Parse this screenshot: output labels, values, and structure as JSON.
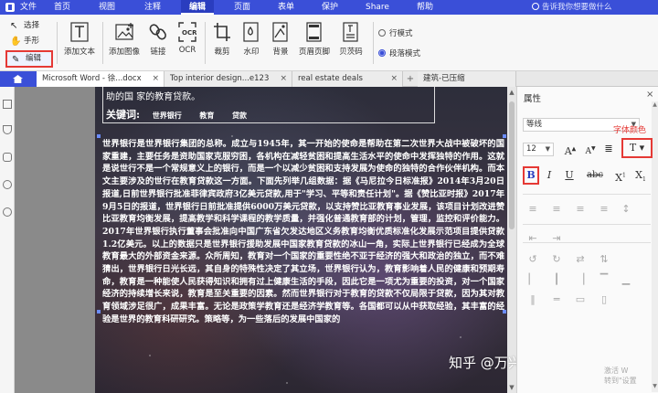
{
  "menu": {
    "items": [
      "文件",
      "首页",
      "视图",
      "注释",
      "编辑",
      "页面",
      "表单",
      "保护",
      "Share",
      "帮助"
    ],
    "active_index": 4,
    "tip": "告诉我你想要做什么"
  },
  "ribbon": {
    "modes": {
      "select": "选择",
      "hand": "手形",
      "edit": "编辑"
    },
    "buttons": {
      "add_text": "添加文本",
      "add_image": "添加图像",
      "link": "链接",
      "ocr": "OCR",
      "crop": "裁剪",
      "watermark": "水印",
      "background": "背景",
      "header_footer": "页眉页脚",
      "bates": "贝茨码"
    },
    "radio": {
      "line_mode": "行模式",
      "paragraph_mode": "段落模式",
      "selected": "paragraph_mode"
    }
  },
  "tabs": [
    {
      "label": "Microsoft Word - 徐...docx",
      "active": true
    },
    {
      "label": "Top interior design...e123",
      "active": false
    },
    {
      "label": "real estate deals",
      "active": false
    },
    {
      "label": "建筑-已压缩",
      "active": false
    }
  ],
  "document": {
    "abstract_tail": "助的国  家的教育贷款。",
    "keywords_label": "关键词:",
    "keywords": [
      "世界银行",
      "教育",
      "贷款"
    ],
    "paragraph": "世界银行是世界银行集团的总称。成立与1945年，其一开始的使命是帮助在第二次世界大战中被破坏的国家重建，主要任务是资助国家克服穷困，各机构在减轻贫困和提高生活水平的使命中发挥独特的作用。这就是说世行不是一个常规意义上的银行，而是一个以减少贫困和支持发展为使命的独特的合作伙伴机构。而本文主要涉及的世行在教育贷款这一方面。下面先列举几组数据：据《马尼拉今日标准报》2014年3月20日报道,日前世界银行批准菲律宾政府3亿美元贷款,用于\"学习、平等和责任计划\"。据《赞比亚时报》2017年9月5日的报道，世界银行日前批准提供6000万美元贷款，以支持赞比亚教育事业发展，该项目计划改进赞比亚教育均衡发展，提高教学和科学课程的教学质量，并强化普通教育部的计划，管理，监控和评价能力。2017年世界银行执行董事会批准向中国广东省欠发达地区义务教育均衡优质标准化发展示范项目提供贷款1.2亿美元。以上的数据只是世界银行援助发展中国家教育贷款的冰山一角，实际上世界银行已经成为全球教育最大的外部资金来源。众所周知，教育对一个国家的重要性绝不亚于经济的强大和政治的独立，而不难猜出，世界银行日光长远，其自身的特殊性决定了其立场，世界银行认为，教育影响着人民的健康和预期寿命，教育是一种能使人民获得知识和拥有过上健康生活的手段，因此它是一项尤为重要的投资，对一个国家经济的持续增长来说，教育是至关重要的因素。然而世界银行对于教育的贷款不仅局限于贷款，因为其对教育领域涉足很广，成果丰富。无论是政策学教育还是经济学教育等。各国都可以从中获取经验，其丰富的经验是世界的教育科研研究。策略等，为一些落后的发展中国家的"
  },
  "watermark": "知乎 @万兴PDF专家",
  "properties": {
    "title": "属性",
    "font_family": "等线",
    "font_size": "12",
    "annotation": "字体颜色",
    "activate": [
      "激活 W",
      "转到\"设置"
    ]
  }
}
